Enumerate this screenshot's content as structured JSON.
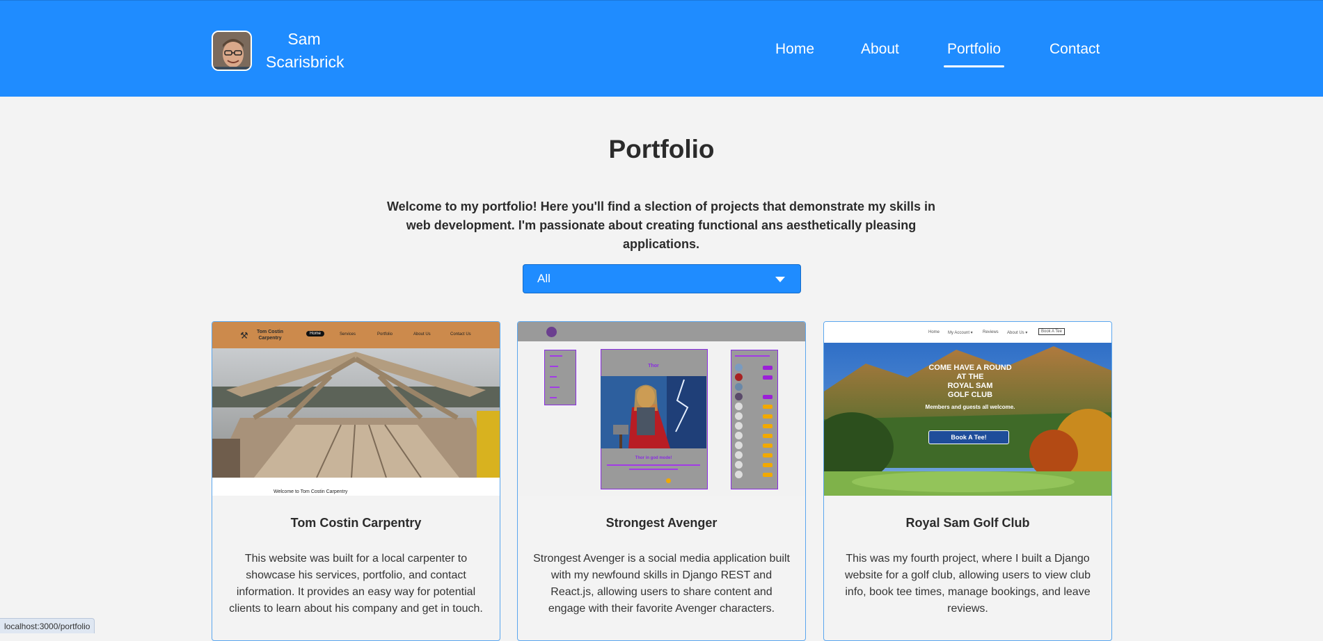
{
  "header": {
    "brand_name_line1": "Sam",
    "brand_name_line2": "Scarisbrick",
    "nav": [
      {
        "label": "Home",
        "active": false
      },
      {
        "label": "About",
        "active": false
      },
      {
        "label": "Portfolio",
        "active": true
      },
      {
        "label": "Contact",
        "active": false
      }
    ]
  },
  "main": {
    "title": "Portfolio",
    "intro": "Welcome to my portfolio! Here you'll find a slection of projects that demonstrate my skills in web development. I'm passionate about creating functional ans aesthetically pleasing applications.",
    "filter_value": "All"
  },
  "projects": [
    {
      "title": "Tom Costin Carpentry",
      "description": "This website was built for a local carpenter to showcase his services, portfolio, and contact information. It provides an easy way for potential clients to learn about his company and get in touch.",
      "thumb": {
        "brand_line1": "Tom Costin",
        "brand_line2": "Carpentry",
        "nav": [
          "Home",
          "Services",
          "Portfolio",
          "About Us",
          "Contact Us"
        ],
        "welcome": "Welcome to Tom Costin Carpentry"
      }
    },
    {
      "title": "Strongest Avenger",
      "description": "Strongest Avenger is a social media application built with my newfound skills in Django REST and React.js, allowing users to share content and engage with their favorite Avenger characters.",
      "thumb": {
        "post_title": "Thor",
        "caption": "Thor in god mode!"
      }
    },
    {
      "title": "Royal Sam Golf Club",
      "description": "This was my fourth project, where I built a Django website for a golf club, allowing users to view club info, book tee times, manage bookings, and leave reviews.",
      "thumb": {
        "nav": [
          "Home",
          "My Account ▾",
          "Reviews",
          "About Us ▾",
          "Book A Tee"
        ],
        "hero_lines": [
          "COME HAVE A ROUND",
          "AT THE",
          "ROYAL SAM",
          "GOLF CLUB"
        ],
        "hero_sub": "Members and guests all welcome.",
        "cta": "Book A Tee!"
      }
    }
  ],
  "status_bar": {
    "url": "localhost:3000/portfolio"
  },
  "colors": {
    "primary": "#1f8cff",
    "background": "#f3f3f3",
    "text": "#2b2b2b"
  }
}
